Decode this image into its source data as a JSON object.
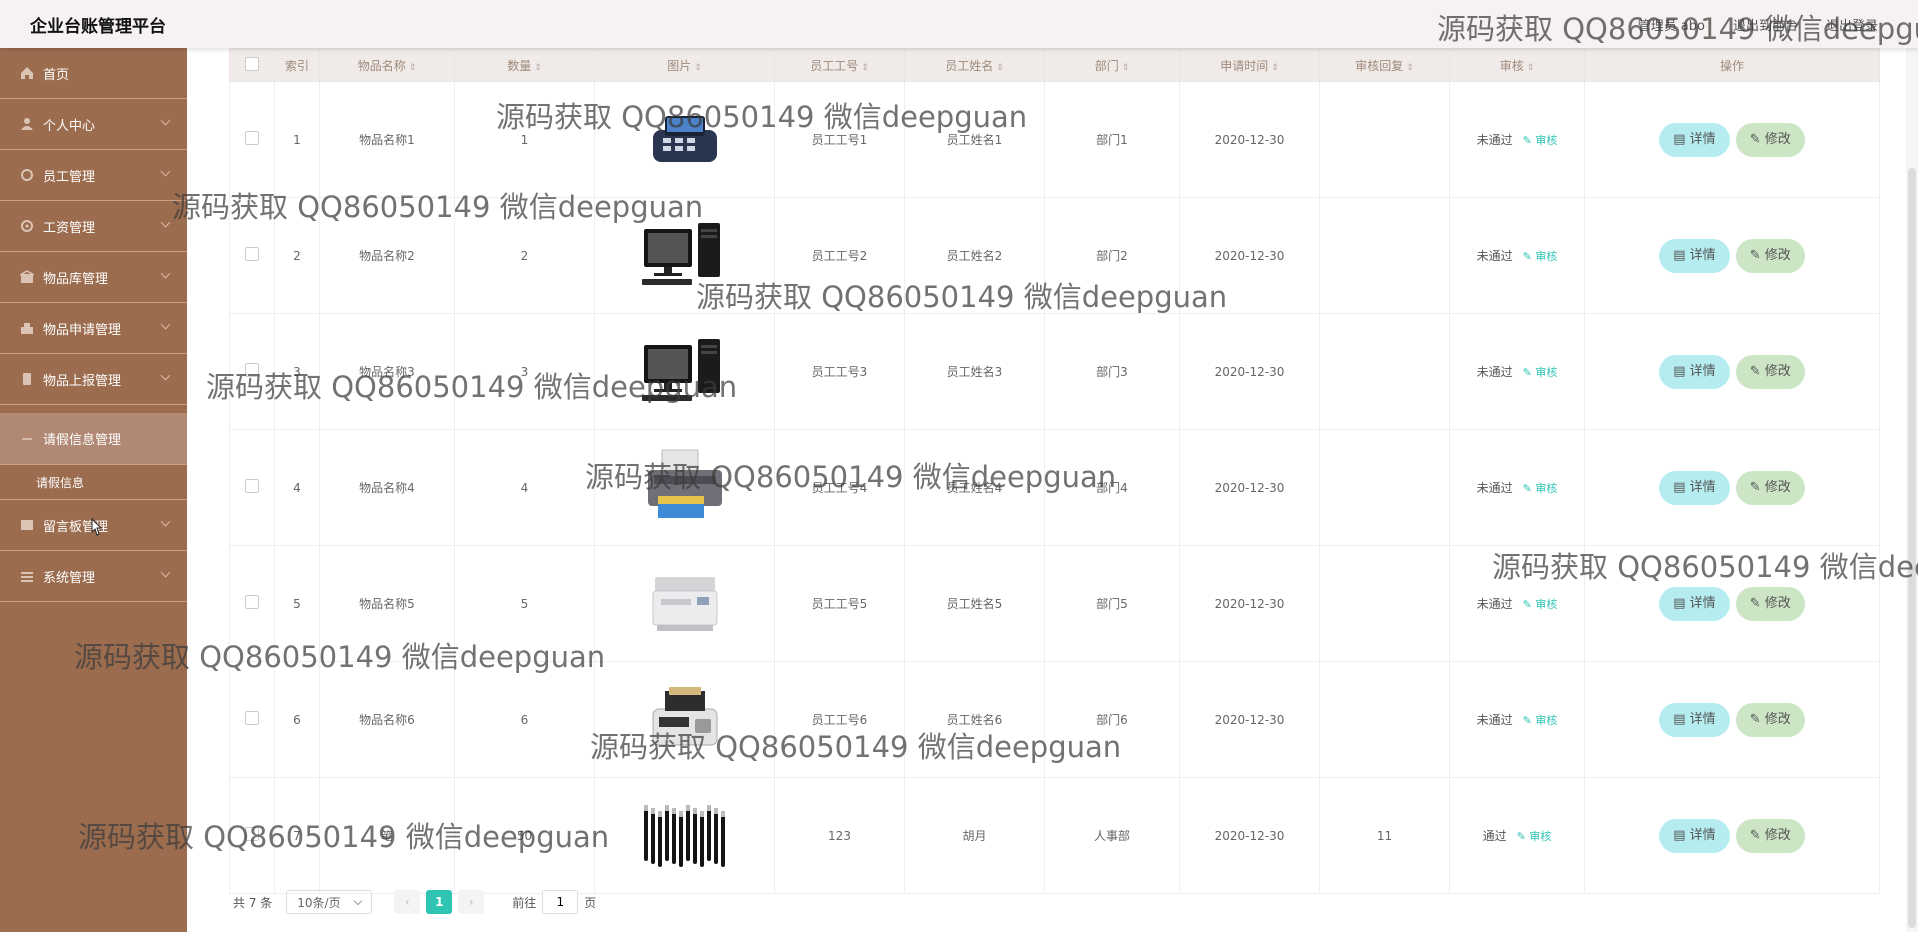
{
  "header": {
    "title": "企业台账管理平台",
    "actions": [
      "管理员 abo",
      "退出到前台",
      "退出登录"
    ]
  },
  "sidebar": {
    "items": [
      {
        "label": "首页",
        "icon": "home-icon"
      },
      {
        "label": "个人中心",
        "icon": "user-icon"
      },
      {
        "label": "员工管理",
        "icon": "staff-icon"
      },
      {
        "label": "工资管理",
        "icon": "salary-icon"
      },
      {
        "label": "物品库管理",
        "icon": "warehouse-icon"
      },
      {
        "label": "物品申请管理",
        "icon": "apply-icon"
      },
      {
        "label": "物品上报管理",
        "icon": "report-icon"
      }
    ],
    "active_item": {
      "label": "请假信息管理"
    },
    "sub_item": {
      "label": "请假信息"
    },
    "items_after": [
      {
        "label": "留言板管理",
        "icon": "message-icon"
      },
      {
        "label": "系统管理",
        "icon": "settings-icon"
      }
    ]
  },
  "table": {
    "headers": [
      "索引",
      "物品名称",
      "数量",
      "图片",
      "员工工号",
      "员工姓名",
      "部门",
      "申请时间",
      "审核回复",
      "审核",
      "操作"
    ],
    "audit_link_label": "审核",
    "detail_label": "详情",
    "edit_label": "修改",
    "rows": [
      {
        "index": "1",
        "name": "物品名称1",
        "qty": "1",
        "image": "pos-terminal",
        "emp_no": "员工工号1",
        "emp_name": "员工姓名1",
        "dept": "部门1",
        "date": "2020-12-30",
        "reply": "",
        "status": "未通过"
      },
      {
        "index": "2",
        "name": "物品名称2",
        "qty": "2",
        "image": "desktop-computer",
        "emp_no": "员工工号2",
        "emp_name": "员工姓名2",
        "dept": "部门2",
        "date": "2020-12-30",
        "reply": "",
        "status": "未通过"
      },
      {
        "index": "3",
        "name": "物品名称3",
        "qty": "3",
        "image": "desktop-computer",
        "emp_no": "员工工号3",
        "emp_name": "员工姓名3",
        "dept": "部门3",
        "date": "2020-12-30",
        "reply": "",
        "status": "未通过"
      },
      {
        "index": "4",
        "name": "物品名称4",
        "qty": "4",
        "image": "printer",
        "emp_no": "员工工号4",
        "emp_name": "员工姓名4",
        "dept": "部门4",
        "date": "2020-12-30",
        "reply": "",
        "status": "未通过"
      },
      {
        "index": "5",
        "name": "物品名称5",
        "qty": "5",
        "image": "copier",
        "emp_no": "员工工号5",
        "emp_name": "员工姓名5",
        "dept": "部门5",
        "date": "2020-12-30",
        "reply": "",
        "status": "未通过"
      },
      {
        "index": "6",
        "name": "物品名称6",
        "qty": "6",
        "image": "money-counter",
        "emp_no": "员工工号6",
        "emp_name": "员工姓名6",
        "dept": "部门6",
        "date": "2020-12-30",
        "reply": "",
        "status": "未通过"
      },
      {
        "index": "7",
        "name": "笔",
        "qty": "50",
        "image": "pens",
        "emp_no": "123",
        "emp_name": "胡月",
        "dept": "人事部",
        "date": "2020-12-30",
        "reply": "11",
        "status": "通过"
      }
    ]
  },
  "pagination": {
    "total_label": "共 7 条",
    "page_size": "10条/页",
    "current_page": "1",
    "goto_label": "前往",
    "goto_value": "1",
    "page_suffix": "页"
  },
  "watermark": {
    "text": "源码获取 QQ86050149 微信deepguan"
  },
  "colors": {
    "sidebar": "#9c6c4f",
    "accent": "#2fc4b4",
    "detail_button": "#b5ecef",
    "edit_button": "#cbe5c5"
  }
}
